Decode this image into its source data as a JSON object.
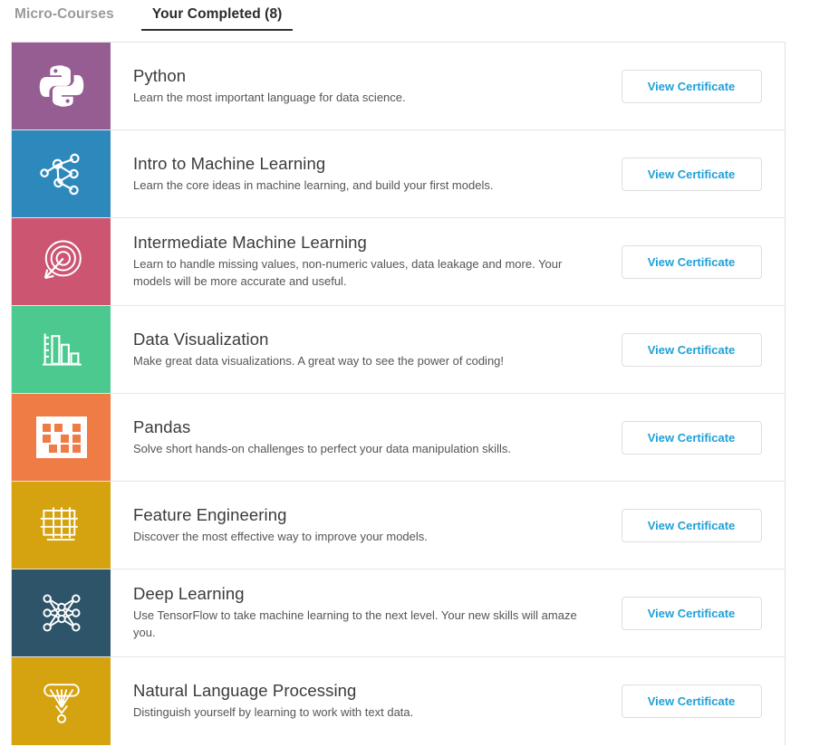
{
  "tabs": [
    {
      "label": "Micro-Courses",
      "active": false
    },
    {
      "label": "Your Completed (8)",
      "active": true
    }
  ],
  "colors": {
    "python_tile": "#965D92",
    "intro_ml_tile": "#2D89BC",
    "intermediate_ml_tile": "#CC5572",
    "data_viz_tile": "#4BC98F",
    "pandas_tile": "#EF7B45",
    "feature_eng_tile": "#D6A310",
    "deep_learning_tile": "#2D5468",
    "nlp_tile": "#D6A310",
    "cta_text": "#20A0D8",
    "tab_active": "#2B2B2B",
    "tab_inactive": "#9A9A9A"
  },
  "courses": [
    {
      "title": "Python",
      "description": "Learn the most important language for data science.",
      "cta": "View Certificate",
      "icon": "python-logo-icon",
      "tile_color": "#965D92"
    },
    {
      "title": "Intro to Machine Learning",
      "description": "Learn the core ideas in machine learning, and build your first models.",
      "cta": "View Certificate",
      "icon": "node-graph-icon",
      "tile_color": "#2D89BC"
    },
    {
      "title": "Intermediate Machine Learning",
      "description": "Learn to handle missing values, non-numeric values, data leakage and more. Your models will be more accurate and useful.",
      "cta": "View Certificate",
      "icon": "target-arrow-icon",
      "tile_color": "#CC5572"
    },
    {
      "title": "Data Visualization",
      "description": "Make great data visualizations. A great way to see the power of coding!",
      "cta": "View Certificate",
      "icon": "bar-chart-icon",
      "tile_color": "#4BC98F"
    },
    {
      "title": "Pandas",
      "description": "Solve short hands-on challenges to perfect your data manipulation skills.",
      "cta": "View Certificate",
      "icon": "data-grid-icon",
      "tile_color": "#EF7B45"
    },
    {
      "title": "Feature Engineering",
      "description": "Discover the most effective way to improve your models.",
      "cta": "View Certificate",
      "icon": "table-grid-icon",
      "tile_color": "#D6A310"
    },
    {
      "title": "Deep Learning",
      "description": "Use TensorFlow to take machine learning to the next level. Your new skills will amaze you.",
      "cta": "View Certificate",
      "icon": "neural-network-icon",
      "tile_color": "#2D5468"
    },
    {
      "title": "Natural Language Processing",
      "description": "Distinguish yourself by learning to work with text data.",
      "cta": "View Certificate",
      "icon": "funnel-attention-icon",
      "tile_color": "#D6A310"
    }
  ]
}
